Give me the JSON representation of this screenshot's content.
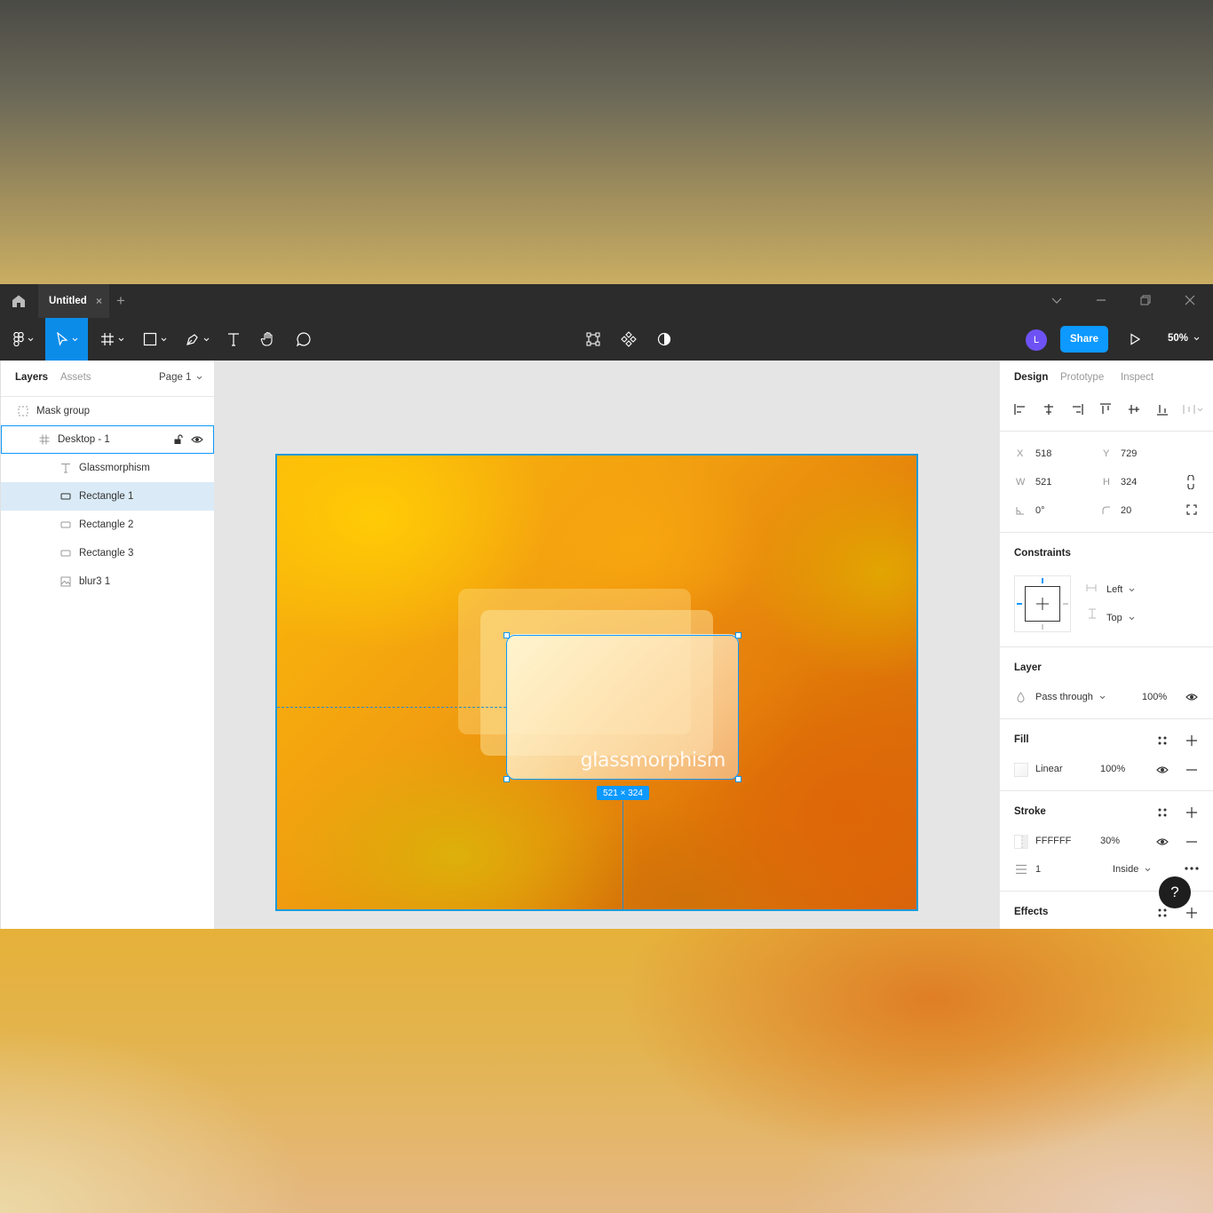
{
  "titlebar": {
    "tab_title": "Untitled",
    "tab_close": "×",
    "add_tab": "+"
  },
  "toolbar": {
    "avatar_initial": "L",
    "share_label": "Share",
    "zoom_label": "50%"
  },
  "left_panel": {
    "tabs": [
      "Layers",
      "Assets"
    ],
    "page_selector": "Page 1",
    "layers": [
      {
        "name": "Mask group",
        "icon": "mask-icon"
      },
      {
        "name": "Desktop - 1",
        "icon": "frame-icon"
      },
      {
        "name": "Glassmorphism",
        "icon": "text-icon"
      },
      {
        "name": "Rectangle 1",
        "icon": "rectangle-icon"
      },
      {
        "name": "Rectangle 2",
        "icon": "rectangle-icon"
      },
      {
        "name": "Rectangle 3",
        "icon": "rectangle-icon"
      },
      {
        "name": "blur3 1",
        "icon": "image-icon"
      }
    ]
  },
  "canvas": {
    "glass_text": "glassmorphism",
    "dimension_label": "521 × 324"
  },
  "right_panel": {
    "tabs": [
      "Design",
      "Prototype",
      "Inspect"
    ],
    "position": {
      "x_label": "X",
      "x": "518",
      "y_label": "Y",
      "y": "729"
    },
    "size": {
      "w_label": "W",
      "w": "521",
      "h_label": "H",
      "h": "324"
    },
    "rotation": "0°",
    "corner_radius": "20",
    "constraints": {
      "title": "Constraints",
      "horizontal": "Left",
      "vertical": "Top"
    },
    "layer": {
      "title": "Layer",
      "blend": "Pass through",
      "opacity": "100%"
    },
    "fill": {
      "title": "Fill",
      "type": "Linear",
      "opacity": "100%"
    },
    "stroke": {
      "title": "Stroke",
      "color": "FFFFFF",
      "opacity": "30%",
      "weight": "1",
      "position": "Inside"
    },
    "effects": {
      "title": "Effects"
    }
  },
  "help_label": "?",
  "colors": {
    "accent": "#0d99ff",
    "toolbar": "#2c2c2c",
    "selection": "#daebf7"
  }
}
